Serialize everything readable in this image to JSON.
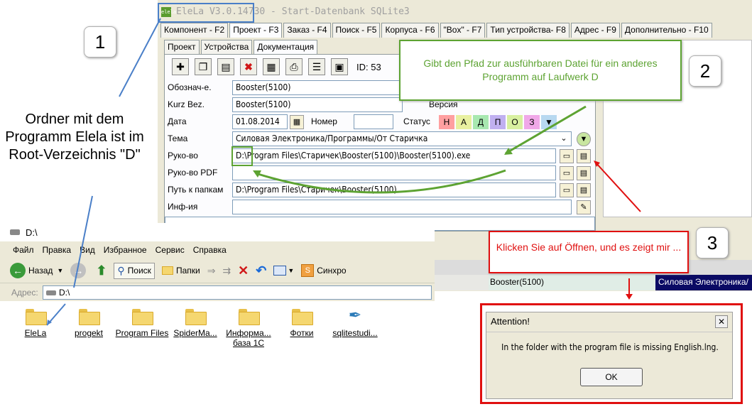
{
  "app": {
    "title": "EleLa V3.0.14730 - Start-Datenbank SQLite3",
    "logo": "elela",
    "top_tabs": [
      "Компонент - F2",
      "Проект - F3",
      "Заказ - F4",
      "Поиск - F5",
      "Корпуса - F6",
      "\"Box\" - F7",
      "Тип устройства- F8",
      "Адрес - F9",
      "Дополнительно - F10"
    ],
    "sub_tabs": [
      "Проект",
      "Устройства",
      "Документация"
    ],
    "id_label": "ID: 53",
    "fields": {
      "oboznach_label": "Обознач-е.",
      "oboznach_value": "Booster(5100)",
      "kurz_label": "Kurz Bez.",
      "kurz_value": "Booster(5100)",
      "version_label": "Версия",
      "date_label": "Дата",
      "date_value": "01.08.2014",
      "nomer_label": "Номер",
      "status_label": "Статус",
      "status_letters": [
        "Н",
        "А",
        "Д",
        "П",
        "О",
        "З"
      ],
      "tema_label": "Тема",
      "tema_value": "Силовая Электроника/Программы/От Старичка",
      "rukovo_label": "Руко-во",
      "rukovo_value": "D:\\Program Files\\Старичек\\Booster(5100)\\Booster(5100).exe",
      "rukovo_pdf_label": "Руко-во PDF",
      "path_label": "Путь к папкам",
      "path_value": "D:\\Program Files\\Старичек\\Booster(5100)",
      "info_label": "Инф-ия"
    },
    "grid_row": {
      "c2": "Booster(5100)",
      "c3": "Силовая Электроника/"
    }
  },
  "explorer": {
    "title": "D:\\",
    "menu": [
      "Файл",
      "Правка",
      "Вид",
      "Избранное",
      "Сервис",
      "Справка"
    ],
    "toolbar": {
      "back": "Назад",
      "search": "Поиск",
      "folders": "Папки",
      "sync": "Синхро"
    },
    "address_label": "Адрес:",
    "address_value": "D:\\",
    "items": [
      {
        "label": "EleLa"
      },
      {
        "label": "progekt"
      },
      {
        "label": "Program Files"
      },
      {
        "label": "SpiderMa..."
      },
      {
        "label": "Информа... база 1С"
      },
      {
        "label": "Фотки"
      },
      {
        "label": "sqlitestudi..."
      }
    ]
  },
  "annotations": {
    "badge1": "1",
    "badge2": "2",
    "badge3": "3",
    "note1": "Ordner mit dem Programm Elela ist im Root-Verzeichnis \"D\"",
    "callout2": "Gibt den Pfad zur ausführbaren Datei für ein anderes Programm auf Laufwerk D",
    "callout3": "Klicken Sie auf Öffnen, und es zeigt mir ..."
  },
  "dialog": {
    "title": "Attention!",
    "message": "In the folder with the program file is missing English.lng.",
    "ok": "OK"
  },
  "colors": {
    "green": "#5da332",
    "red": "#e01010",
    "blue_line": "#4a7fc8"
  }
}
